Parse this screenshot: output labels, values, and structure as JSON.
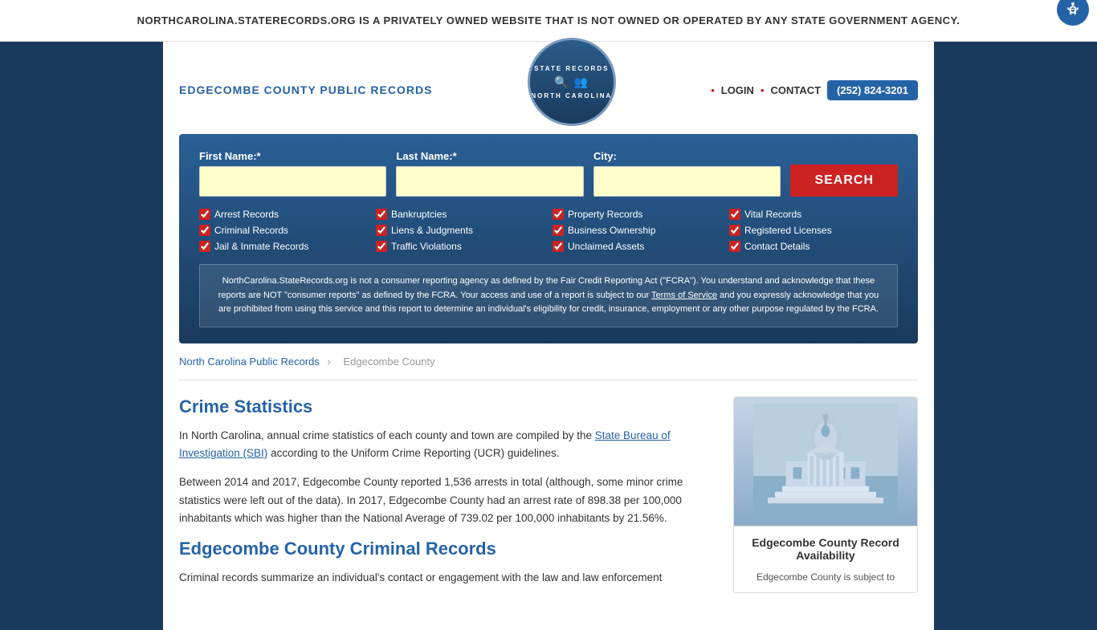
{
  "banner": {
    "text": "NORTHCAROLINA.STATERECORDS.ORG IS A PRIVATELY OWNED WEBSITE THAT IS NOT OWNED OR OPERATED BY ANY STATE GOVERNMENT AGENCY.",
    "close_label": "×"
  },
  "header": {
    "site_title": "EDGECOMBE COUNTY PUBLIC RECORDS",
    "logo_top": "STATE RECORDS",
    "logo_bottom": "NORTH CAROLINA",
    "nav_login": "LOGIN",
    "nav_contact": "CONTACT",
    "phone": "(252) 824-3201"
  },
  "search": {
    "first_name_label": "First Name:*",
    "last_name_label": "Last Name:*",
    "city_label": "City:",
    "first_name_placeholder": "",
    "last_name_placeholder": "",
    "city_placeholder": "",
    "search_button": "SEARCH",
    "checkboxes": [
      {
        "label": "Arrest Records",
        "checked": true
      },
      {
        "label": "Bankruptcies",
        "checked": true
      },
      {
        "label": "Property Records",
        "checked": true
      },
      {
        "label": "Vital Records",
        "checked": true
      },
      {
        "label": "Criminal Records",
        "checked": true
      },
      {
        "label": "Liens & Judgments",
        "checked": true
      },
      {
        "label": "Business Ownership",
        "checked": true
      },
      {
        "label": "Registered Licenses",
        "checked": true
      },
      {
        "label": "Jail & Inmate Records",
        "checked": true
      },
      {
        "label": "Traffic Violations",
        "checked": true
      },
      {
        "label": "Unclaimed Assets",
        "checked": true
      },
      {
        "label": "Contact Details",
        "checked": true
      }
    ],
    "disclaimer": "NorthCarolina.StateRecords.org is not a consumer reporting agency as defined by the Fair Credit Reporting Act (\"FCRA\"). You understand and acknowledge that these reports are NOT \"consumer reports\" as defined by the FCRA. Your access and use of a report is subject to our Terms of Service and you expressly acknowledge that you are prohibited from using this service and this report to determine an individual's eligibility for credit, insurance, employment or any other purpose regulated by the FCRA."
  },
  "breadcrumb": {
    "parent_link": "North Carolina Public Records",
    "current": "Edgecombe County"
  },
  "content": {
    "crime_stats_title": "Crime Statistics",
    "crime_stats_p1": "In North Carolina, annual crime statistics of each county and town are compiled by the State Bureau of Investigation (SBI) according to the Uniform Crime Reporting (UCR) guidelines.",
    "crime_stats_link": "State Bureau of Investigation (SBI)",
    "crime_stats_p2": "Between 2014 and 2017, Edgecombe County reported 1,536 arrests in total (although, some minor crime statistics were left out of the data). In 2017, Edgecombe County had an arrest rate of 898.38 per 100,000 inhabitants which was higher than the National Average of 739.02 per 100,000 inhabitants by 21.56%.",
    "criminal_records_title": "Edgecombe County Criminal Records",
    "criminal_records_p1": "Criminal records summarize an individual's contact or engagement with the law and law enforcement"
  },
  "sidebar": {
    "card_title": "Edgecombe County Record Availability",
    "card_subtitle": "Edgecombe County is subject to"
  }
}
